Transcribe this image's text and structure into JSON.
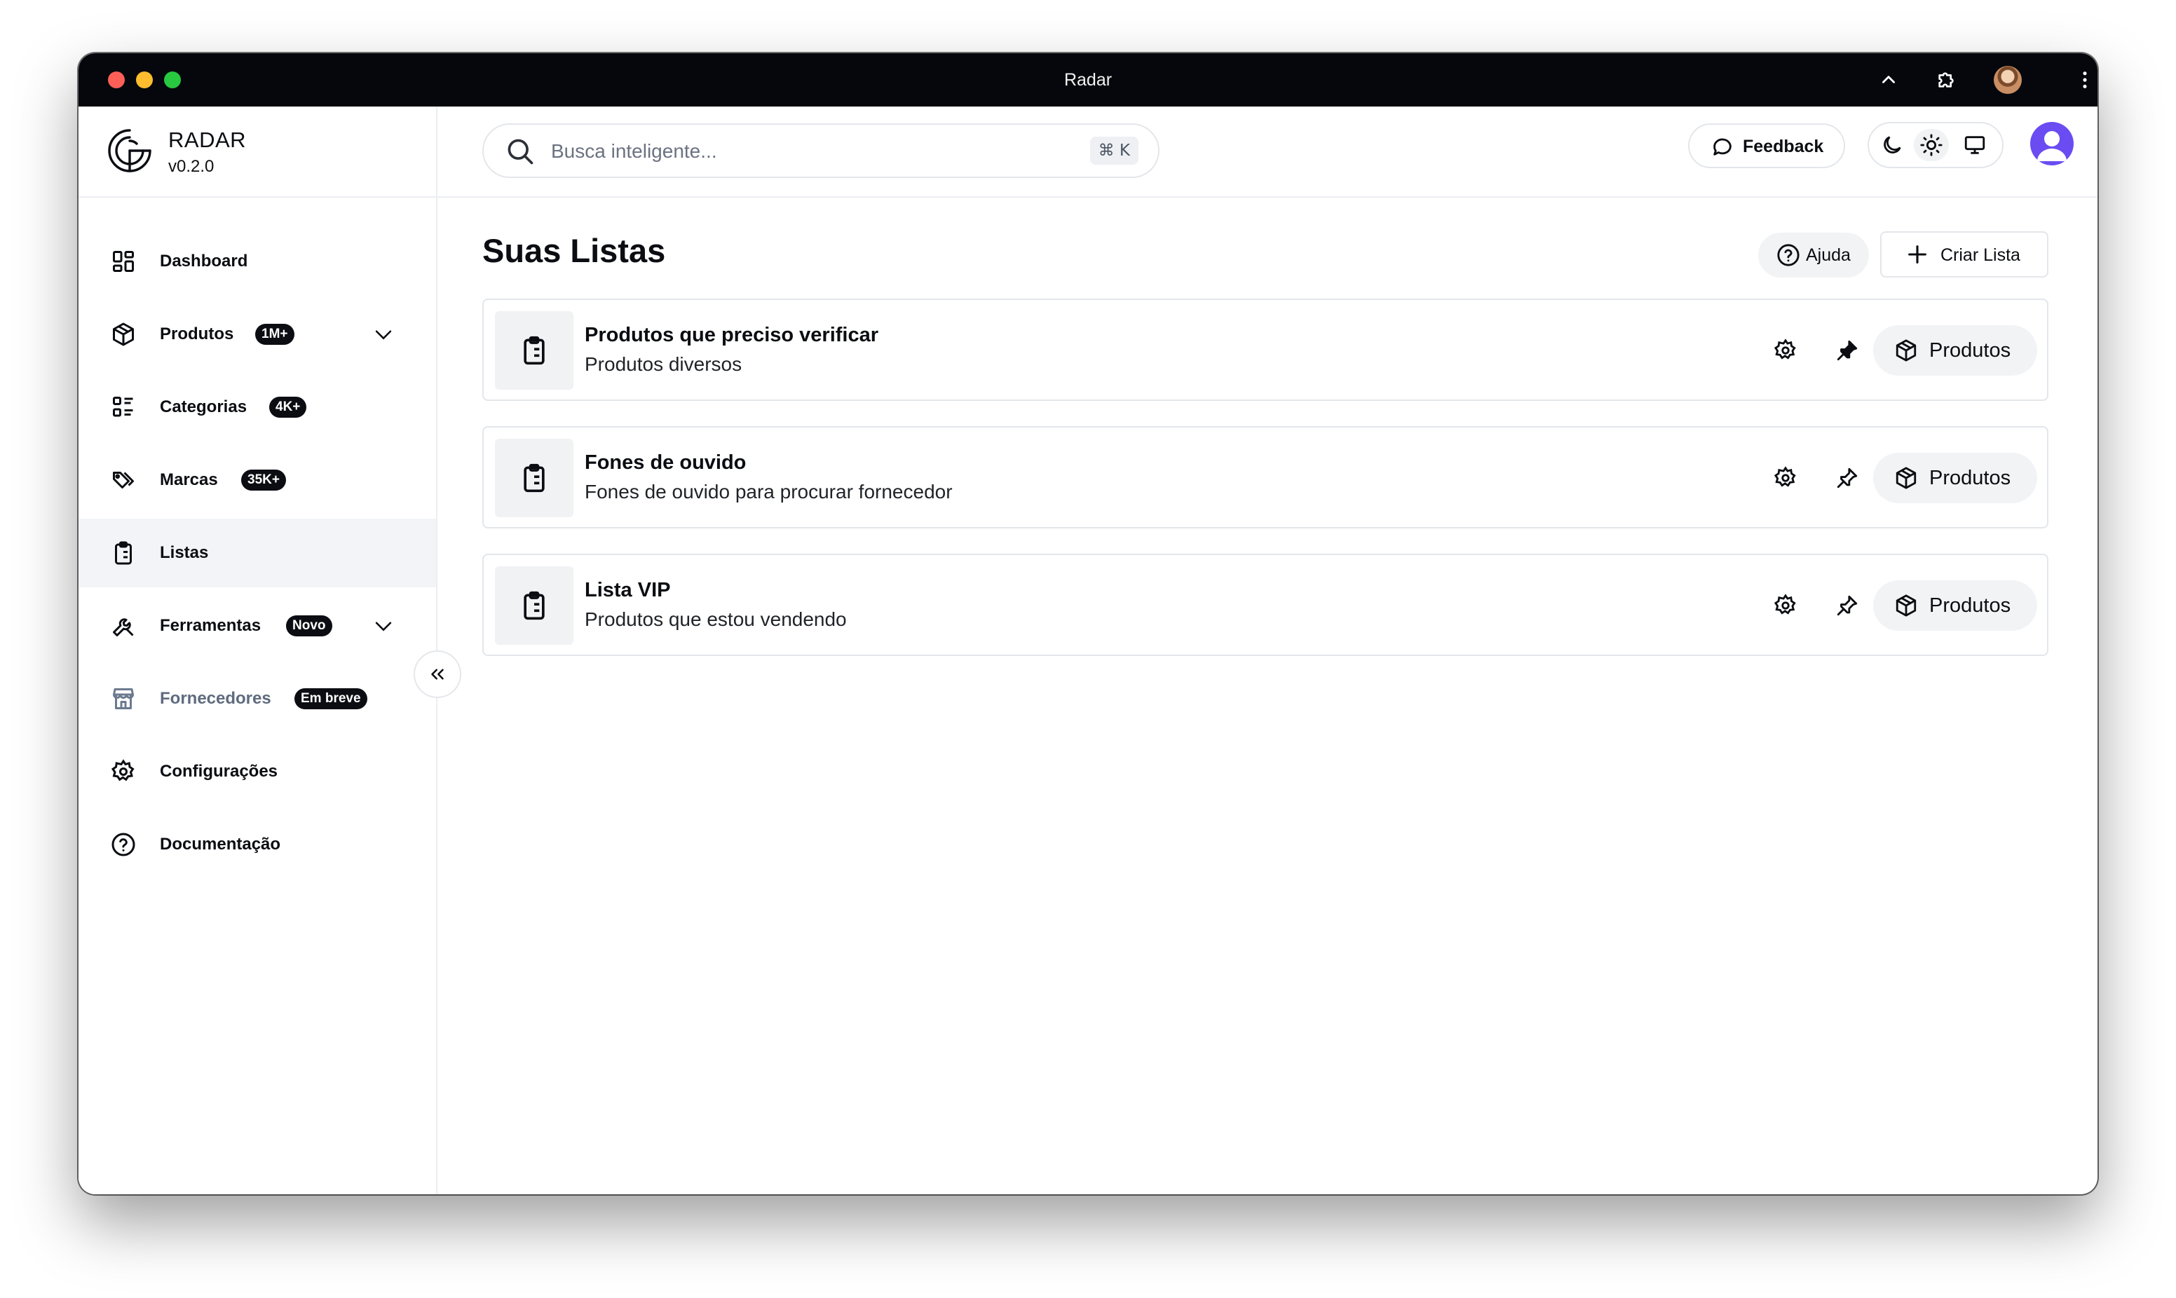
{
  "window": {
    "title": "Radar"
  },
  "brand": {
    "name": "RADAR",
    "version": "v0.2.0"
  },
  "sidebar": {
    "items": [
      {
        "label": "Dashboard"
      },
      {
        "label": "Produtos",
        "badge": "1M+"
      },
      {
        "label": "Categorias",
        "badge": "4K+"
      },
      {
        "label": "Marcas",
        "badge": "35K+"
      },
      {
        "label": "Listas"
      },
      {
        "label": "Ferramentas",
        "badge": "Novo"
      },
      {
        "label": "Fornecedores",
        "badge": "Em breve"
      },
      {
        "label": "Configurações"
      },
      {
        "label": "Documentação"
      }
    ],
    "active": "Listas"
  },
  "header": {
    "search_placeholder": "Busca inteligente...",
    "shortcut": "⌘ K",
    "feedback_label": "Feedback"
  },
  "main": {
    "title": "Suas Listas",
    "help_label": "Ajuda",
    "create_label": "Criar Lista",
    "lists": [
      {
        "title": "Produtos que preciso verificar",
        "subtitle": "Produtos diversos",
        "pinned": true,
        "action_label": "Produtos"
      },
      {
        "title": "Fones de ouvido",
        "subtitle": "Fones de ouvido para procurar fornecedor",
        "pinned": false,
        "action_label": "Produtos"
      },
      {
        "title": "Lista VIP",
        "subtitle": "Produtos que estou vendendo",
        "pinned": false,
        "action_label": "Produtos"
      }
    ]
  },
  "colors": {
    "badge_bg": "#0b0d12",
    "active_bg": "#f2f4f7",
    "avatar": "#6a4cf2"
  }
}
